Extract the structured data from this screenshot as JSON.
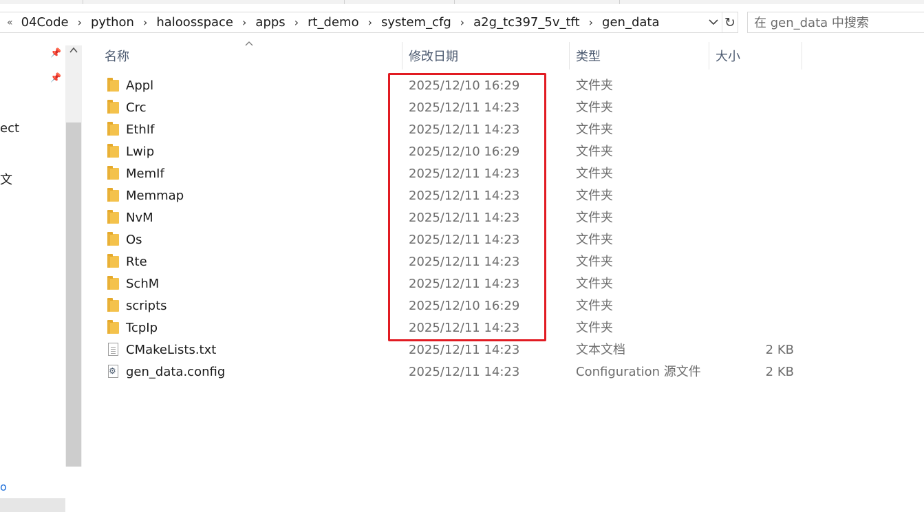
{
  "address_bar": {
    "back_glyph": "«",
    "breadcrumbs": [
      "04Code",
      "python",
      "haloosspace",
      "apps",
      "rt_demo",
      "system_cfg",
      "a2g_tc397_5v_tft",
      "gen_data"
    ],
    "separator": "›"
  },
  "search": {
    "placeholder": "在 gen_data 中搜索"
  },
  "nav": {
    "partial_items": [
      "ect",
      "文"
    ],
    "partial_blue": "o"
  },
  "columns": {
    "name": "名称",
    "date": "修改日期",
    "type": "类型",
    "size": "大小"
  },
  "files": [
    {
      "name": "Appl",
      "date": "2025/12/10 16:29",
      "type": "文件夹",
      "size": "",
      "icon": "folder-icon"
    },
    {
      "name": "Crc",
      "date": "2025/12/11 14:23",
      "type": "文件夹",
      "size": "",
      "icon": "folder-icon"
    },
    {
      "name": "EthIf",
      "date": "2025/12/11 14:23",
      "type": "文件夹",
      "size": "",
      "icon": "folder-icon"
    },
    {
      "name": "Lwip",
      "date": "2025/12/10 16:29",
      "type": "文件夹",
      "size": "",
      "icon": "folder-icon"
    },
    {
      "name": "MemIf",
      "date": "2025/12/11 14:23",
      "type": "文件夹",
      "size": "",
      "icon": "folder-icon"
    },
    {
      "name": "Memmap",
      "date": "2025/12/11 14:23",
      "type": "文件夹",
      "size": "",
      "icon": "folder-icon"
    },
    {
      "name": "NvM",
      "date": "2025/12/11 14:23",
      "type": "文件夹",
      "size": "",
      "icon": "folder-icon"
    },
    {
      "name": "Os",
      "date": "2025/12/11 14:23",
      "type": "文件夹",
      "size": "",
      "icon": "folder-icon"
    },
    {
      "name": "Rte",
      "date": "2025/12/11 14:23",
      "type": "文件夹",
      "size": "",
      "icon": "folder-icon"
    },
    {
      "name": "SchM",
      "date": "2025/12/11 14:23",
      "type": "文件夹",
      "size": "",
      "icon": "folder-icon"
    },
    {
      "name": "scripts",
      "date": "2025/12/10 16:29",
      "type": "文件夹",
      "size": "",
      "icon": "folder-icon"
    },
    {
      "name": "TcpIp",
      "date": "2025/12/11 14:23",
      "type": "文件夹",
      "size": "",
      "icon": "folder-icon"
    },
    {
      "name": "CMakeLists.txt",
      "date": "2025/12/11 14:23",
      "type": "文本文档",
      "size": "2 KB",
      "icon": "text-file-icon"
    },
    {
      "name": "gen_data.config",
      "date": "2025/12/11 14:23",
      "type": "Configuration 源文件",
      "size": "2 KB",
      "icon": "config-file-icon"
    }
  ],
  "colors": {
    "highlight_box": "#e11b22",
    "folder": "#f4c24c",
    "header_text": "#4c5a70"
  }
}
